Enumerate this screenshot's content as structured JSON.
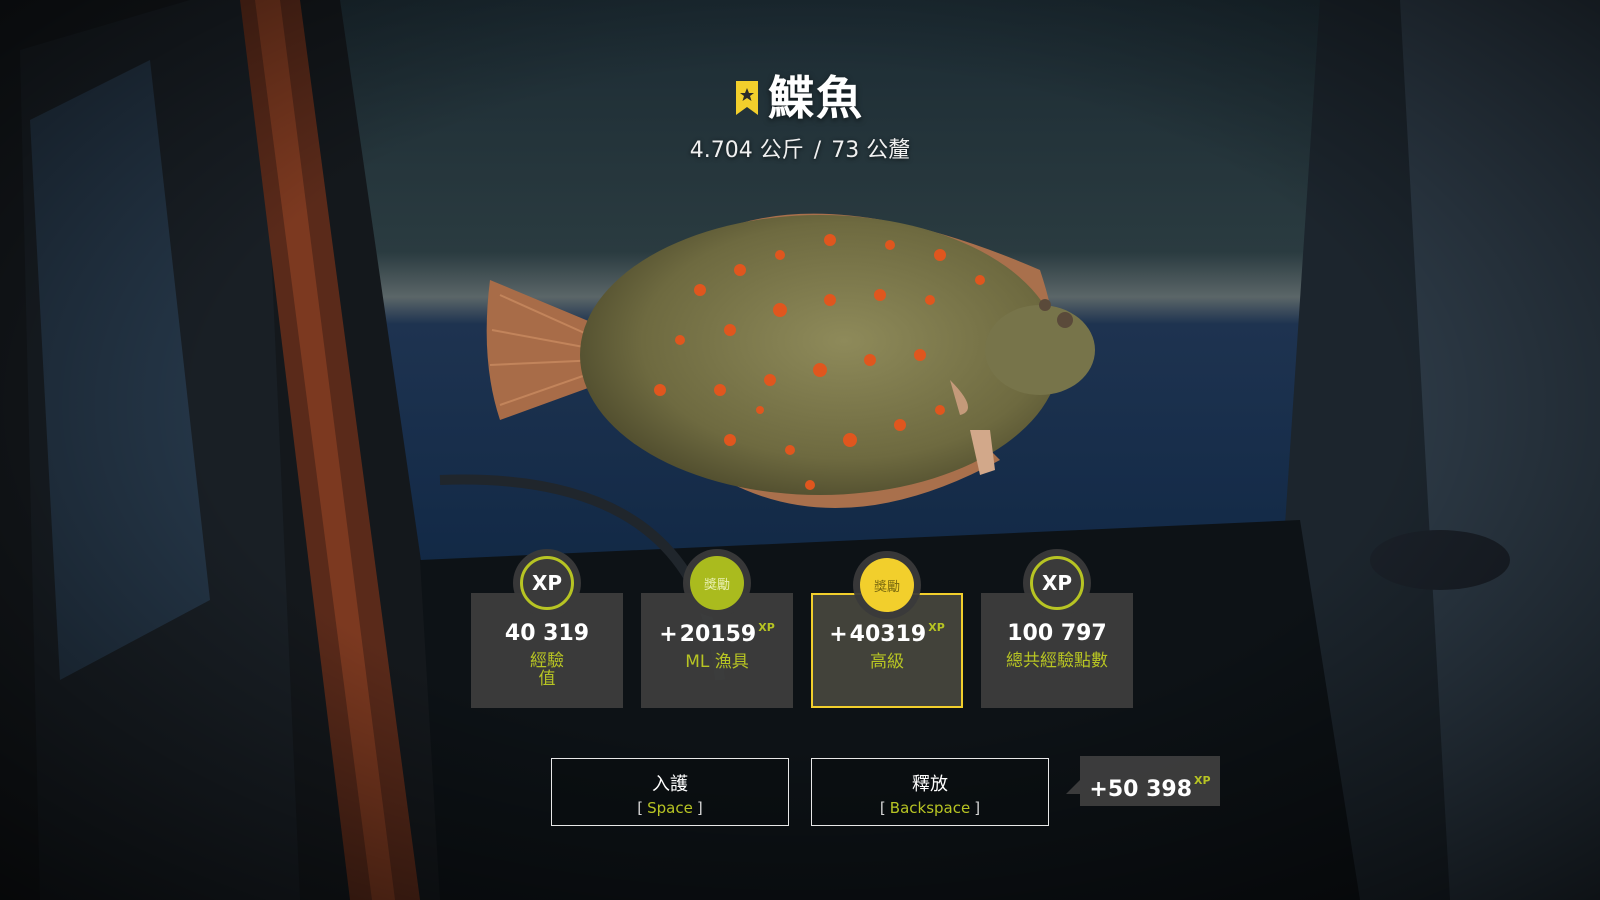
{
  "catch": {
    "fish_name": "鰈魚",
    "weight": "4.704 公斤",
    "separator": "/",
    "length": "73 公釐"
  },
  "rewards": [
    {
      "badge": "XP",
      "value": "40 319",
      "plus": "",
      "xp_suffix": "",
      "label": "經驗值"
    },
    {
      "badge": "獎勵",
      "value": "20159",
      "plus": "+",
      "xp_suffix": "XP",
      "label": "ML 漁具"
    },
    {
      "badge": "獎勵",
      "value": "40319",
      "plus": "+",
      "xp_suffix": "XP",
      "label": "高級"
    },
    {
      "badge": "XP",
      "value": "100 797",
      "plus": "",
      "xp_suffix": "",
      "label": "總共經驗點數"
    }
  ],
  "actions": {
    "keep": {
      "label": "入護",
      "key_open": "[",
      "key": "Space",
      "key_close": "]"
    },
    "release": {
      "label": "釋放",
      "key_open": "[",
      "key": "Backspace",
      "key_close": "]"
    }
  },
  "release_bonus": {
    "plus": "+",
    "value": "50 398",
    "xp_suffix": "XP"
  },
  "colors": {
    "accent_green": "#b7c423",
    "accent_yellow": "#f2cf2c",
    "panel": "#3e3e3e"
  },
  "icons": {
    "trophy": "trophy-bookmark-icon",
    "fish": "flounder-image"
  }
}
